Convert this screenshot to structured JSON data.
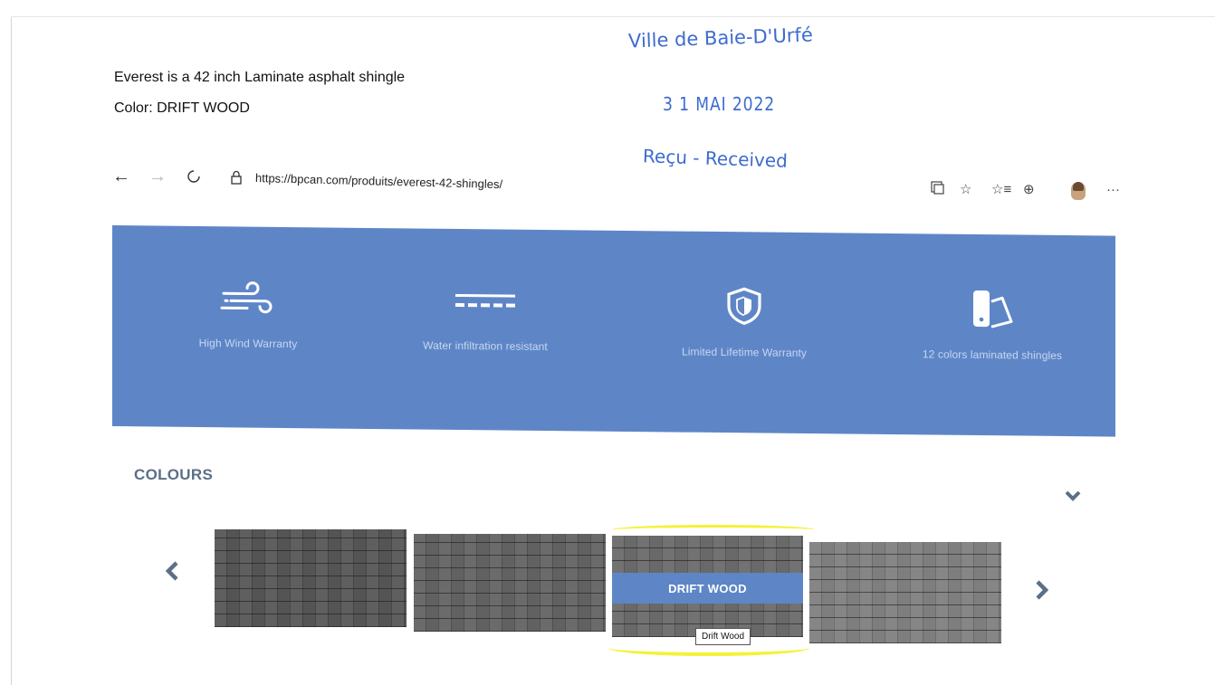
{
  "description": {
    "line1": "Everest is a 42 inch Laminate asphalt shingle",
    "line2": "Color: DRIFT WOOD"
  },
  "stamp": {
    "city": "Ville de Baie-D'Urfé",
    "date": "3 1 MAI 2022",
    "received": "Reçu - Received",
    "color": "#3d6ccf"
  },
  "browser": {
    "url": "https://bpcan.com/produits/everest-42-shingles/",
    "icons": {
      "back": "←",
      "forward": "→",
      "refresh": "↻",
      "lock": "🔒",
      "reader": "⧉",
      "favorite": "☆",
      "favorites": "☆≡",
      "collections": "⊕",
      "more": "···"
    }
  },
  "features": [
    {
      "label": "High Wind Warranty",
      "icon": "wind-icon"
    },
    {
      "label": "Water infiltration resistant",
      "icon": "water-layer-icon"
    },
    {
      "label": "Limited Lifetime Warranty",
      "icon": "shield-icon"
    },
    {
      "label": "12 colors laminated shingles",
      "icon": "color-swatch-icon"
    }
  ],
  "colours": {
    "heading": "COLOURS",
    "selected_band": "DRIFT WOOD",
    "tooltip": "Drift Wood"
  },
  "colors": {
    "banner": "#5e86c7",
    "highlight": "#f4f236",
    "heading": "#5b6f88"
  }
}
